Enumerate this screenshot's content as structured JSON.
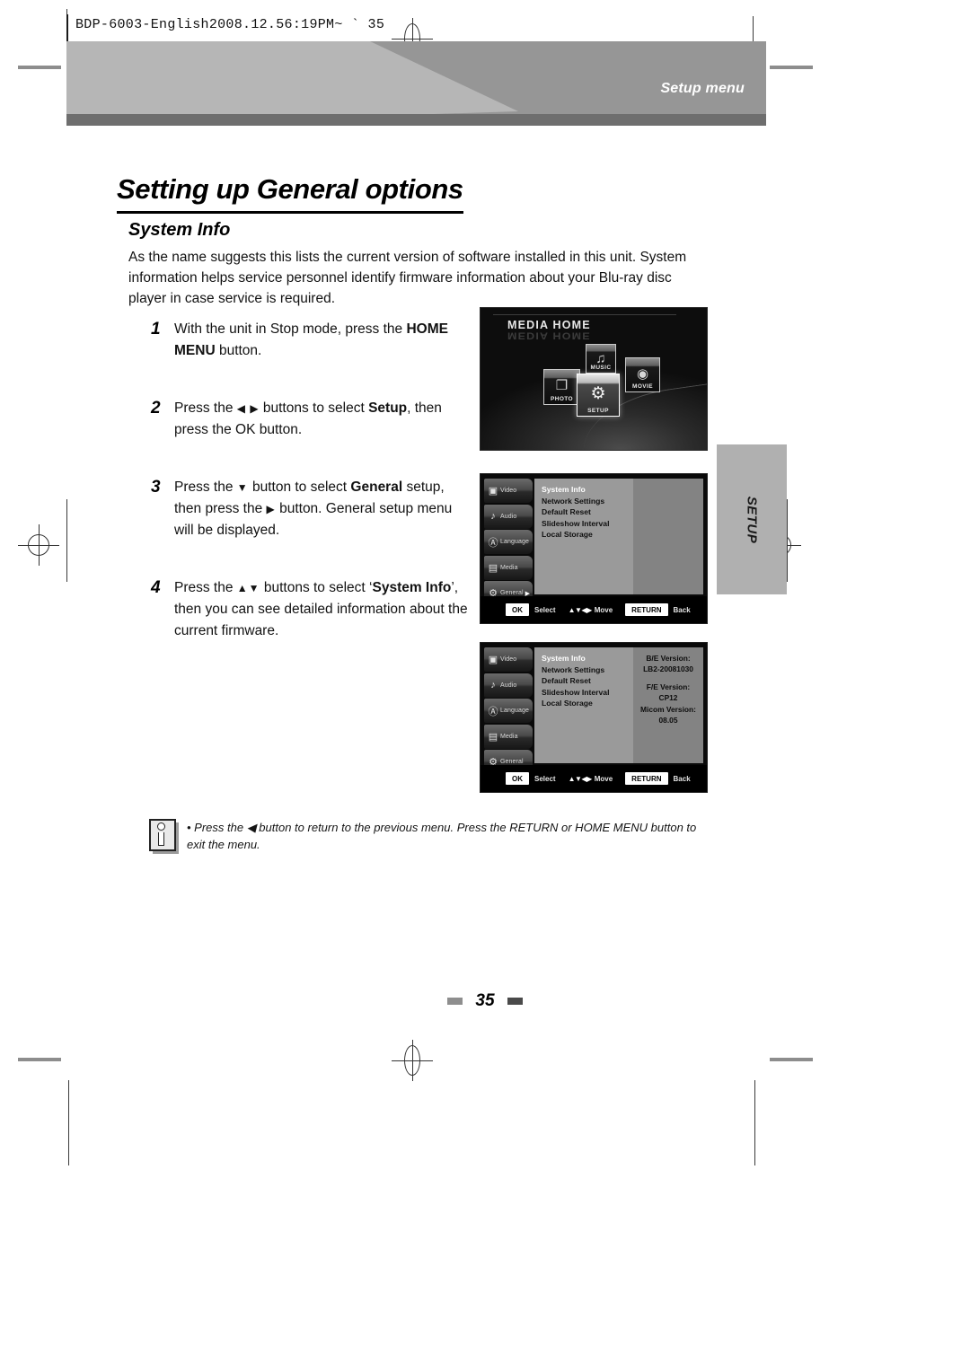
{
  "scan": {
    "header_label": "BDP-6003-English2008.12.56:19PM~ ` 35"
  },
  "banner": {
    "category": "Setup menu"
  },
  "page": {
    "title": "Setting up General options",
    "section": "System Info",
    "intro": "As the name suggests this lists the current version of software installed in this unit. System information helps service personnel identify firmware information about your Blu-ray disc player in case service is required.",
    "page_number": "35"
  },
  "side_tab": {
    "label": "SETUP"
  },
  "steps": [
    {
      "number": "1",
      "parts": [
        {
          "t": "With the unit in Stop mode, press the ",
          "b": false
        },
        {
          "t": "HOME MENU",
          "b": true
        },
        {
          "t": " button.",
          "b": false
        }
      ]
    },
    {
      "number": "2",
      "parts": [
        {
          "t": "Press the ",
          "b": false
        },
        {
          "t": "◀ ▶",
          "b": false,
          "arrow": true
        },
        {
          "t": " buttons to select ",
          "b": false
        },
        {
          "t": "Setup",
          "b": true
        },
        {
          "t": ", then press the OK button.",
          "b": false
        }
      ]
    },
    {
      "number": "3",
      "parts": [
        {
          "t": "Press the ",
          "b": false
        },
        {
          "t": "▼",
          "b": false,
          "arrow": true
        },
        {
          "t": " button to select ",
          "b": false
        },
        {
          "t": "General",
          "b": true
        },
        {
          "t": " setup, then press the ",
          "b": false
        },
        {
          "t": "▶",
          "b": false,
          "arrow": true
        },
        {
          "t": " button. General setup menu will be displayed.",
          "b": false
        }
      ]
    },
    {
      "number": "4",
      "parts": [
        {
          "t": "Press the ",
          "b": false
        },
        {
          "t": "▲▼",
          "b": false,
          "arrow": true
        },
        {
          "t": " buttons to select ‘",
          "b": false
        },
        {
          "t": "System Info",
          "b": true
        },
        {
          "t": "’, then you can see detailed information about the current firmware.",
          "b": false
        }
      ]
    }
  ],
  "media_home": {
    "title": "MEDIA HOME",
    "tiles": [
      {
        "caption": "PHOTO",
        "icon": "photo-icon",
        "glyph": "❐",
        "selected": false
      },
      {
        "caption": "MUSIC",
        "icon": "music-icon",
        "glyph": "♫",
        "selected": false
      },
      {
        "caption": "SETUP",
        "icon": "gear-icon",
        "glyph": "⚙",
        "selected": true
      },
      {
        "caption": "MOVIE",
        "icon": "movie-reel-icon",
        "glyph": "◉",
        "selected": false
      }
    ]
  },
  "osd": {
    "sidebar": [
      {
        "label": "Video",
        "icon": "monitor-icon",
        "glyph": "▣",
        "arrow": ""
      },
      {
        "label": "Audio",
        "icon": "speaker-icon",
        "glyph": "♪",
        "arrow": ""
      },
      {
        "label": "Language",
        "icon": "abc-icon",
        "glyph": "Ⓐ",
        "arrow": ""
      },
      {
        "label": "Media",
        "icon": "film-icon",
        "glyph": "▤",
        "arrow": ""
      },
      {
        "label": "General",
        "icon": "gear-icon",
        "glyph": "⚙",
        "arrow": "▶"
      }
    ],
    "menu_items": [
      "System Info",
      "Network Settings",
      "Default Reset",
      "Slideshow Interval",
      "Local Storage"
    ],
    "active_item": "System Info",
    "bottom_bar": {
      "ok_key": "OK",
      "ok_text": "Select",
      "move_pad": "▲▼◀▶",
      "move_text": "Move",
      "return_key": "RETURN",
      "return_text": "Back"
    },
    "version_info": [
      {
        "label": "B/E Version:",
        "value": "LB2-20081030"
      },
      {
        "label": "F/E Version:",
        "value": "CP12"
      },
      {
        "label": "Micom Version:",
        "value": "08.05"
      }
    ]
  },
  "note": {
    "text": "• Press the ◀ button to return to the previous menu. Press the RETURN or HOME MENU button to exit the menu."
  },
  "colors": {
    "banner_light": "#b6b6b6",
    "banner_mid": "#969696",
    "banner_strip": "#6e6e6e",
    "side_tab": "#b0b0b0",
    "osd_mid_panel": "#9a9a9a",
    "osd_right_panel": "#838383"
  }
}
